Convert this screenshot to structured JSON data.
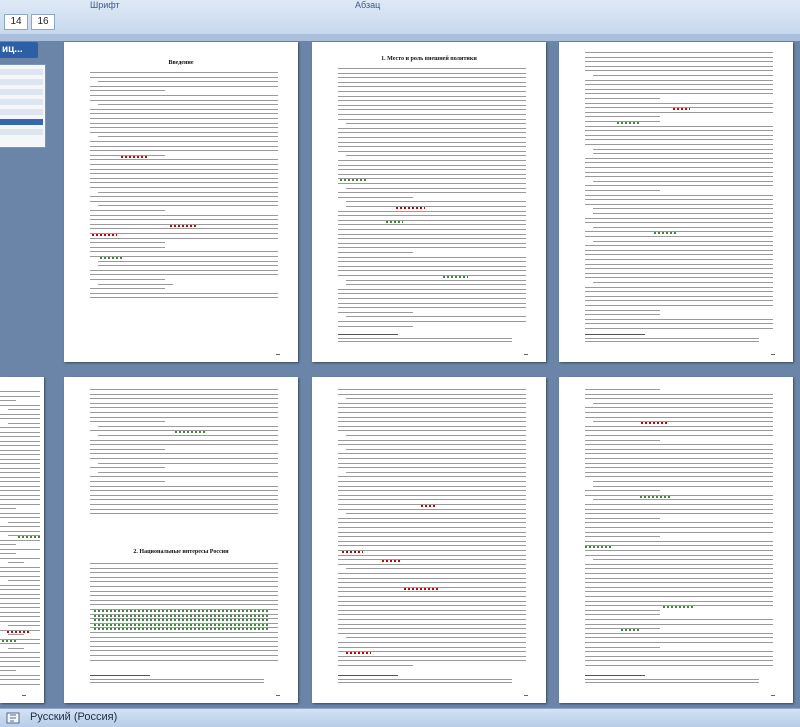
{
  "ribbon": {
    "font_group_label": "Шрифт",
    "para_group_label": "Абзац",
    "font_size_values": [
      "14",
      "16"
    ]
  },
  "sidebar": {
    "title": "иц..."
  },
  "pages": [
    {
      "heading": "Введение"
    },
    {
      "heading": "1.        Место и роль внешней политики"
    },
    {
      "heading": ""
    },
    {
      "heading": ""
    },
    {
      "heading": ""
    },
    {
      "heading": "2.        Национальные интересы России"
    },
    {
      "heading": ""
    },
    {
      "heading": ""
    }
  ],
  "statusbar": {
    "language": "Русский (Россия)"
  },
  "colors": {
    "ribbon": "#c7d8ee",
    "workspace": "#6b85a8",
    "page": "#ffffff",
    "statusbar": "#c6d7ee"
  }
}
